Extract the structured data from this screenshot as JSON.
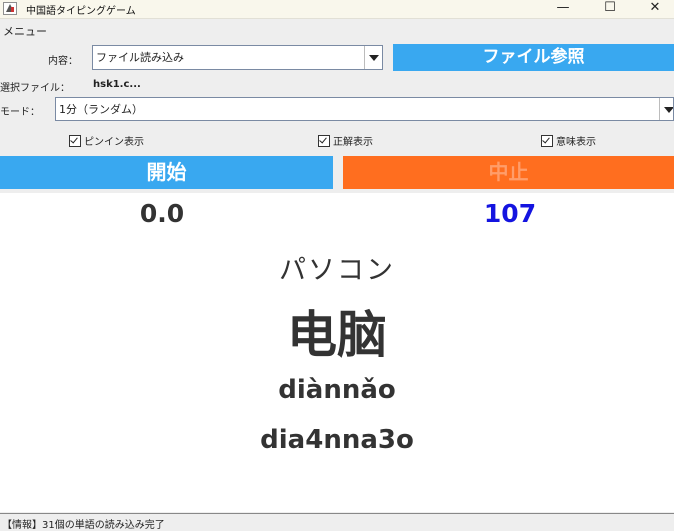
{
  "window": {
    "title": "中国語タイピングゲーム",
    "minimize": "—",
    "maximize": "☐",
    "close": "✕"
  },
  "menu": {
    "label": "メニュー"
  },
  "form": {
    "content_label": "内容：",
    "content_value": "ファイル読み込み",
    "browse_button": "ファイル参照",
    "selected_file_label": "選択ファイル：",
    "selected_file_value": "hsk1.c...",
    "mode_label": "モード：",
    "mode_value": "1分（ランダム）"
  },
  "options": {
    "pinyin": {
      "label": "ピンイン表示",
      "checked": true
    },
    "answer": {
      "label": "正解表示",
      "checked": true
    },
    "meaning": {
      "label": "意味表示",
      "checked": true
    }
  },
  "buttons": {
    "start": "開始",
    "stop": "中止"
  },
  "game": {
    "timer": "0.0",
    "count": "107",
    "meaning": "パソコン",
    "hanzi": "电脑",
    "pinyin": "diànnǎo",
    "typing": "dia4nna3o"
  },
  "status": {
    "text": "【情報】31個の単語の読み込み完了"
  },
  "colors": {
    "accent_blue": "#39a8f0",
    "stop_orange": "#ff6e1f",
    "count_blue": "#1414e0"
  }
}
